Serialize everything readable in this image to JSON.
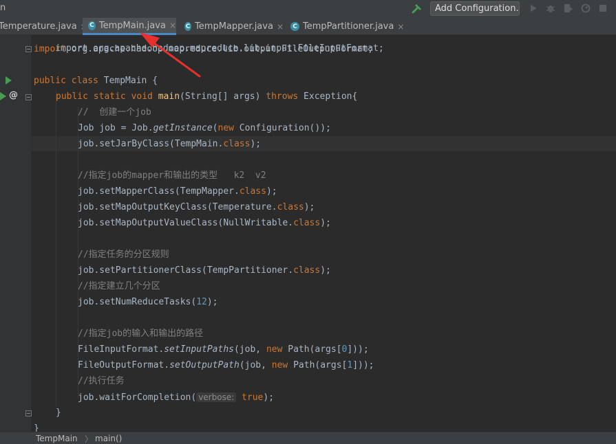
{
  "toolbar": {
    "nav_fragment": "n",
    "add_configuration_label": "Add Configuration...",
    "icons": [
      "hammer-icon",
      "run-icon",
      "debug-icon",
      "coverage-icon",
      "profile-icon",
      "stop-icon"
    ]
  },
  "tabs": [
    {
      "label": "Temperature.java",
      "icon": "",
      "active": false
    },
    {
      "label": "TempMain.java",
      "icon": "C",
      "active": true
    },
    {
      "label": "TempMapper.java",
      "icon": "C",
      "active": false
    },
    {
      "label": "TempPartitioner.java",
      "icon": "C",
      "active": false
    }
  ],
  "tab_close_glyph": "×",
  "gutter": {
    "at_symbol": "@"
  },
  "code": {
    "l0": "import org.apache.hadoop.mapreduce.lib.input.FileInputFormat;",
    "l1_kw": "import",
    "l1_rest": " org.apache.hadoop.mapreduce.lib.output.FileOutputFormat;",
    "l3_kw": "public class",
    "l3_rest": " TempMain {",
    "l4_kw1": "public static void",
    "l4_fn": "main",
    "l4_mid": "(String[] args) ",
    "l4_kw2": "throws",
    "l4_end": " Exception{",
    "l5_cm": "//  创建一个job",
    "l6_a": "Job job = Job.",
    "l6_it": "getInstance",
    "l6_b": "(",
    "l6_kw": "new",
    "l6_c": " Configuration());",
    "l7_a": "job.setJarByClass(TempMain.",
    "l7_kw": "class",
    "l7_b": ");",
    "l9_cm": "//指定job的mapper和输出的类型   k2  v2",
    "l10_a": "job.setMapperClass(TempMapper.",
    "l10_kw": "class",
    "l10_b": ");",
    "l11_a": "job.setMapOutputKeyClass(Temperature.",
    "l11_kw": "class",
    "l11_b": ");",
    "l12_a": "job.setMapOutputValueClass(NullWritable.",
    "l12_kw": "class",
    "l12_b": ");",
    "l14_cm": "//指定任务的分区规则",
    "l15_a": "job.setPartitionerClass(TempPartitioner.",
    "l15_kw": "class",
    "l15_b": ");",
    "l16_cm": "//指定建立几个分区",
    "l17_a": "job.setNumReduceTasks(",
    "l17_num": "12",
    "l17_b": ");",
    "l19_cm": "//指定job的输入和输出的路径",
    "l20_a": "FileInputFormat.",
    "l20_it": "setInputPaths",
    "l20_b": "(job, ",
    "l20_kw": "new",
    "l20_c": " Path(args[",
    "l20_num": "0",
    "l20_d": "]));",
    "l21_a": "FileOutputFormat.",
    "l21_it": "setOutputPath",
    "l21_b": "(job, ",
    "l21_kw": "new",
    "l21_c": " Path(args[",
    "l21_num": "1",
    "l21_d": "]));",
    "l22_cm": "//执行任务",
    "l23_a": "job.waitForCompletion(",
    "l23_hint": "verbose:",
    "l23_kw": "true",
    "l23_b": ");",
    "l24": "}",
    "l25": "}"
  },
  "status": {
    "crumb1": "TempMain",
    "crumb2": "main()",
    "sep": "〉"
  },
  "colors": {
    "keyword": "#cc7832",
    "method": "#ffc66d",
    "comment": "#808080",
    "number": "#6897bb",
    "annotation_arrow": "#e8312c"
  }
}
